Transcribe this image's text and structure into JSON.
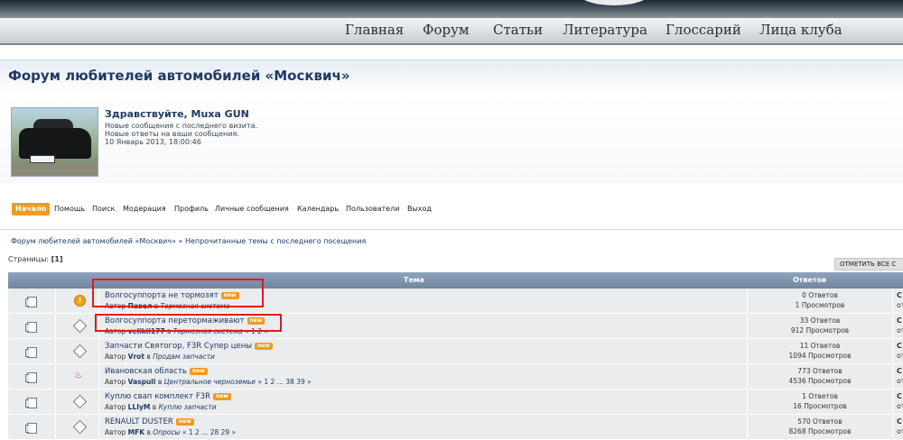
{
  "nav": {
    "items": [
      "Главная",
      "Форум",
      "Статьи",
      "Литература",
      "Глоссарий",
      "Лица клуба"
    ]
  },
  "forum_title": "Форум любителей автомобилей «Москвич»",
  "user": {
    "greeting": "Здравствуйте, Muxa GUN",
    "line1": "Новые сообщения с последнего визита.",
    "line2": "Новые ответы на ваши сообщения.",
    "datetime": "10 Январь 2013, 18:00:46"
  },
  "menu": {
    "home": "Начало",
    "items": [
      "Помощь",
      "Поиск",
      "Модерация",
      "Профиль",
      "Личные сообщения",
      "Календарь",
      "Пользователи",
      "Выход"
    ]
  },
  "breadcrumb": {
    "root": "Форум любителей автомобилей «Москвич»",
    "separator": "»",
    "current": "Непрочитанные темы с последнего посещения"
  },
  "pagination": {
    "label": "Страницы:",
    "current": "[1]"
  },
  "mark_read_label": "ОТМЕТИТЬ ВСЕ С",
  "table": {
    "col_topic": "Тема",
    "col_replies": "Ответов",
    "author_prefix": "Автор",
    "in_word": "в",
    "new_label": "new",
    "rows": [
      {
        "icon": "warning-icon",
        "title": "Волгосуппорта не тормозят",
        "author": "Павел",
        "forum": "Тормозная система",
        "pages": "",
        "replies": "0 Ответов",
        "views": "1 Просмотров",
        "last_top": "С",
        "last_bottom": "от"
      },
      {
        "icon": "diamond-icon",
        "title": "Волгосуппорта перетормаживают",
        "author": "velikii177",
        "forum": "Тормозная система",
        "pages": "« 1 2 »",
        "replies": "33 Ответов",
        "views": "912 Просмотров",
        "last_top": "С",
        "last_bottom": "от"
      },
      {
        "icon": "diamond-icon",
        "title": "Запчасти Святогор, F3R Супер цены",
        "author": "Vrot",
        "forum": "Продам запчасти",
        "pages": "",
        "replies": "11 Ответов",
        "views": "1094 Просмотров",
        "last_top": "С",
        "last_bottom": "от"
      },
      {
        "icon": "hot-icon",
        "title": "Ивановская область",
        "author": "Vaspull",
        "forum": "Центральное черноземье",
        "pages": "« 1 2 ... 38 39 »",
        "replies": "773 Ответов",
        "views": "4536 Просмотров",
        "last_top": "С",
        "last_bottom": "от"
      },
      {
        "icon": "diamond-icon",
        "title": "Куплю свап комплект F3R",
        "author": "LLIyM",
        "forum": "Куплю запчасти",
        "pages": "",
        "replies": "1 Ответов",
        "views": "16 Просмотров",
        "last_top": "С",
        "last_bottom": "от"
      },
      {
        "icon": "diamond-icon",
        "title": "RENAULT DUSTER",
        "author": "MFK",
        "forum": "Опросы",
        "pages": "« 1 2 ... 28 29 »",
        "replies": "570 Ответов",
        "views": "8268 Просмотров",
        "last_top": "С",
        "last_bottom": "от"
      }
    ]
  },
  "colors": {
    "accent": "#ef9b22",
    "link": "#213a64",
    "highlight": "#e0191b",
    "header_bar": "#7b90aa"
  }
}
